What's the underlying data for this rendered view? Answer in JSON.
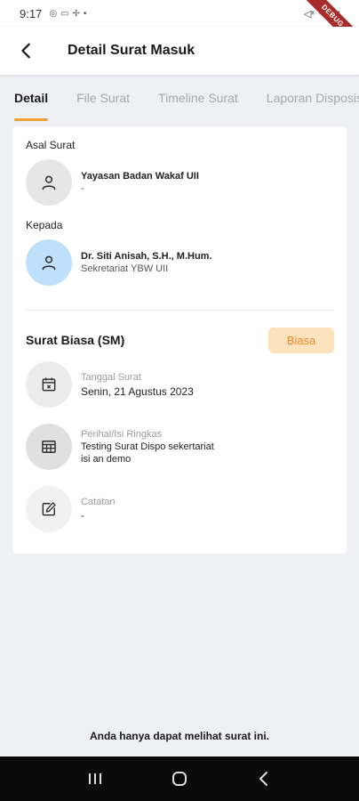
{
  "status_bar": {
    "time": "9:17",
    "debug_label": "DEBUG"
  },
  "app_bar": {
    "title": "Detail Surat Masuk"
  },
  "tabs": [
    {
      "label": "Detail",
      "active": true
    },
    {
      "label": "File Surat",
      "active": false
    },
    {
      "label": "Timeline Surat",
      "active": false
    },
    {
      "label": "Laporan Disposisi",
      "active": false
    }
  ],
  "sender": {
    "section_label": "Asal Surat",
    "name": "Yayasan Badan Wakaf UII",
    "sub": "-"
  },
  "recipient": {
    "section_label": "Kepada",
    "name": "Dr. Siti Anisah, S.H., M.Hum.",
    "sub": "Sekretariat YBW UII"
  },
  "letter": {
    "type": "Surat Biasa (SM)",
    "badge": "Biasa",
    "date_label": "Tanggal Surat",
    "date_value": "Senin, 21 Agustus 2023",
    "subject_label": "Perihal/Isi Ringkas",
    "subject_value_line1": "Testing Surat Dispo sekertariat",
    "subject_value_line2": "isi an demo",
    "notes_label": "Catatan",
    "notes_value": "-"
  },
  "footer": {
    "notice": "Anda hanya dapat melihat surat ini."
  },
  "colors": {
    "accent": "#f0a13a",
    "badge_bg": "#fde3bd",
    "badge_text": "#f0892a",
    "recipient_avatar": "#bfe0fb"
  }
}
